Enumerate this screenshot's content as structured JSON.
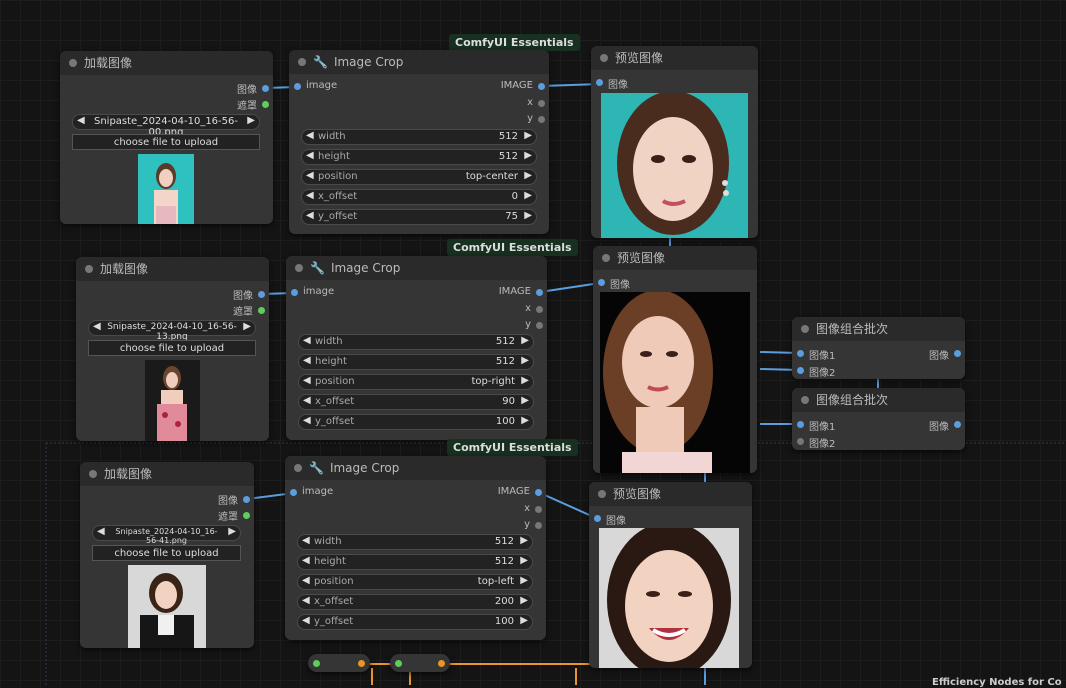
{
  "load_nodes": [
    {
      "title": "加载图像",
      "out_image": "图像",
      "out_mask": "遮罩",
      "filename": "Snipaste_2024-04-10_16-56-00.png",
      "upload": "choose file to upload"
    },
    {
      "title": "加载图像",
      "out_image": "图像",
      "out_mask": "遮罩",
      "filename": "Snipaste_2024-04-10_16-56-13.png",
      "upload": "choose file to upload"
    },
    {
      "title": "加载图像",
      "out_image": "图像",
      "out_mask": "遮罩",
      "filename": "Snipaste_2024-04-10_16-56-41.png",
      "upload": "choose file to upload"
    }
  ],
  "crop_nodes": [
    {
      "badge": "ComfyUI Essentials",
      "title": "Image Crop",
      "in_image": "image",
      "out_image": "IMAGE",
      "out_x": "x",
      "out_y": "y",
      "params": [
        {
          "label": "width",
          "value": "512"
        },
        {
          "label": "height",
          "value": "512"
        },
        {
          "label": "position",
          "value": "top-center"
        },
        {
          "label": "x_offset",
          "value": "0"
        },
        {
          "label": "y_offset",
          "value": "75"
        }
      ]
    },
    {
      "badge": "ComfyUI Essentials",
      "title": "Image Crop",
      "in_image": "image",
      "out_image": "IMAGE",
      "out_x": "x",
      "out_y": "y",
      "params": [
        {
          "label": "width",
          "value": "512"
        },
        {
          "label": "height",
          "value": "512"
        },
        {
          "label": "position",
          "value": "top-right"
        },
        {
          "label": "x_offset",
          "value": "90"
        },
        {
          "label": "y_offset",
          "value": "100"
        }
      ]
    },
    {
      "badge": "ComfyUI Essentials",
      "title": "Image Crop",
      "in_image": "image",
      "out_image": "IMAGE",
      "out_x": "x",
      "out_y": "y",
      "params": [
        {
          "label": "width",
          "value": "512"
        },
        {
          "label": "height",
          "value": "512"
        },
        {
          "label": "position",
          "value": "top-left"
        },
        {
          "label": "x_offset",
          "value": "200"
        },
        {
          "label": "y_offset",
          "value": "100"
        }
      ]
    }
  ],
  "preview_nodes": [
    {
      "title": "预览图像",
      "in_image": "图像"
    },
    {
      "title": "预览图像",
      "in_image": "图像"
    },
    {
      "title": "预览图像",
      "in_image": "图像"
    }
  ],
  "batch_nodes": [
    {
      "title": "图像组合批次",
      "in1": "图像1",
      "in2": "图像2",
      "out": "图像"
    },
    {
      "title": "图像组合批次",
      "in1": "图像1",
      "in2": "图像2",
      "out": "图像"
    }
  ],
  "footer": {
    "partial_label": "Efficiency Nodes for Co"
  },
  "colors": {
    "image_wire": "#5a9ee0",
    "mask_pin": "#5ad05a",
    "misc_wire": "#e8952b",
    "badge_bg": "#17301f",
    "node_bg": "#353535"
  }
}
